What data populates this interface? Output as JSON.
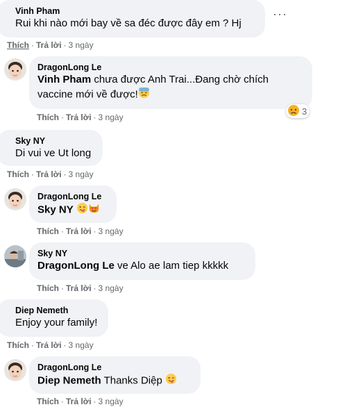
{
  "comments": [
    {
      "author": "Vinh Pham",
      "text": "Rui khi nào mới bay về sa đéc được đây em ? Hj",
      "like": "Thích",
      "reply": "Trả lời",
      "time": "3 ngày"
    },
    {
      "author": "DragonLong Le",
      "mention": "Vinh Pham",
      "text_line1": " chưa được Anh Trai...Đang chờ chích",
      "text_line2": "vaccine mới về được!",
      "like": "Thích",
      "reply": "Trả lời",
      "time": "3 ngày",
      "reaction_count": "3",
      "reaction_icon": "sad-face"
    },
    {
      "author": "Sky NY",
      "text": "Di vui ve Ut long",
      "like": "Thích",
      "reply": "Trả lời",
      "time": "3 ngày"
    },
    {
      "author": "DragonLong Le",
      "mention": "Sky NY",
      "text": "",
      "like": "Thích",
      "reply": "Trả lời",
      "time": "3 ngày"
    },
    {
      "author": "Sky NY",
      "mention": "DragonLong Le",
      "text": " ve Alo ae lam tiep kkkkk",
      "like": "Thích",
      "reply": "Trả lời",
      "time": "3 ngày"
    },
    {
      "author": "Diep Nemeth",
      "text": "Enjoy your family!",
      "like": "Thích",
      "reply": "Trả lời",
      "time": "3 ngày"
    },
    {
      "author": "DragonLong Le",
      "mention": "Diep Nemeth",
      "text": " Thanks Diệp",
      "like": "Thích",
      "reply": "Trả lời",
      "time": "3 ngày"
    }
  ],
  "colors": {
    "bubble": "#f0f2f5",
    "secondary_text": "#65676b",
    "primary_text": "#050505"
  }
}
